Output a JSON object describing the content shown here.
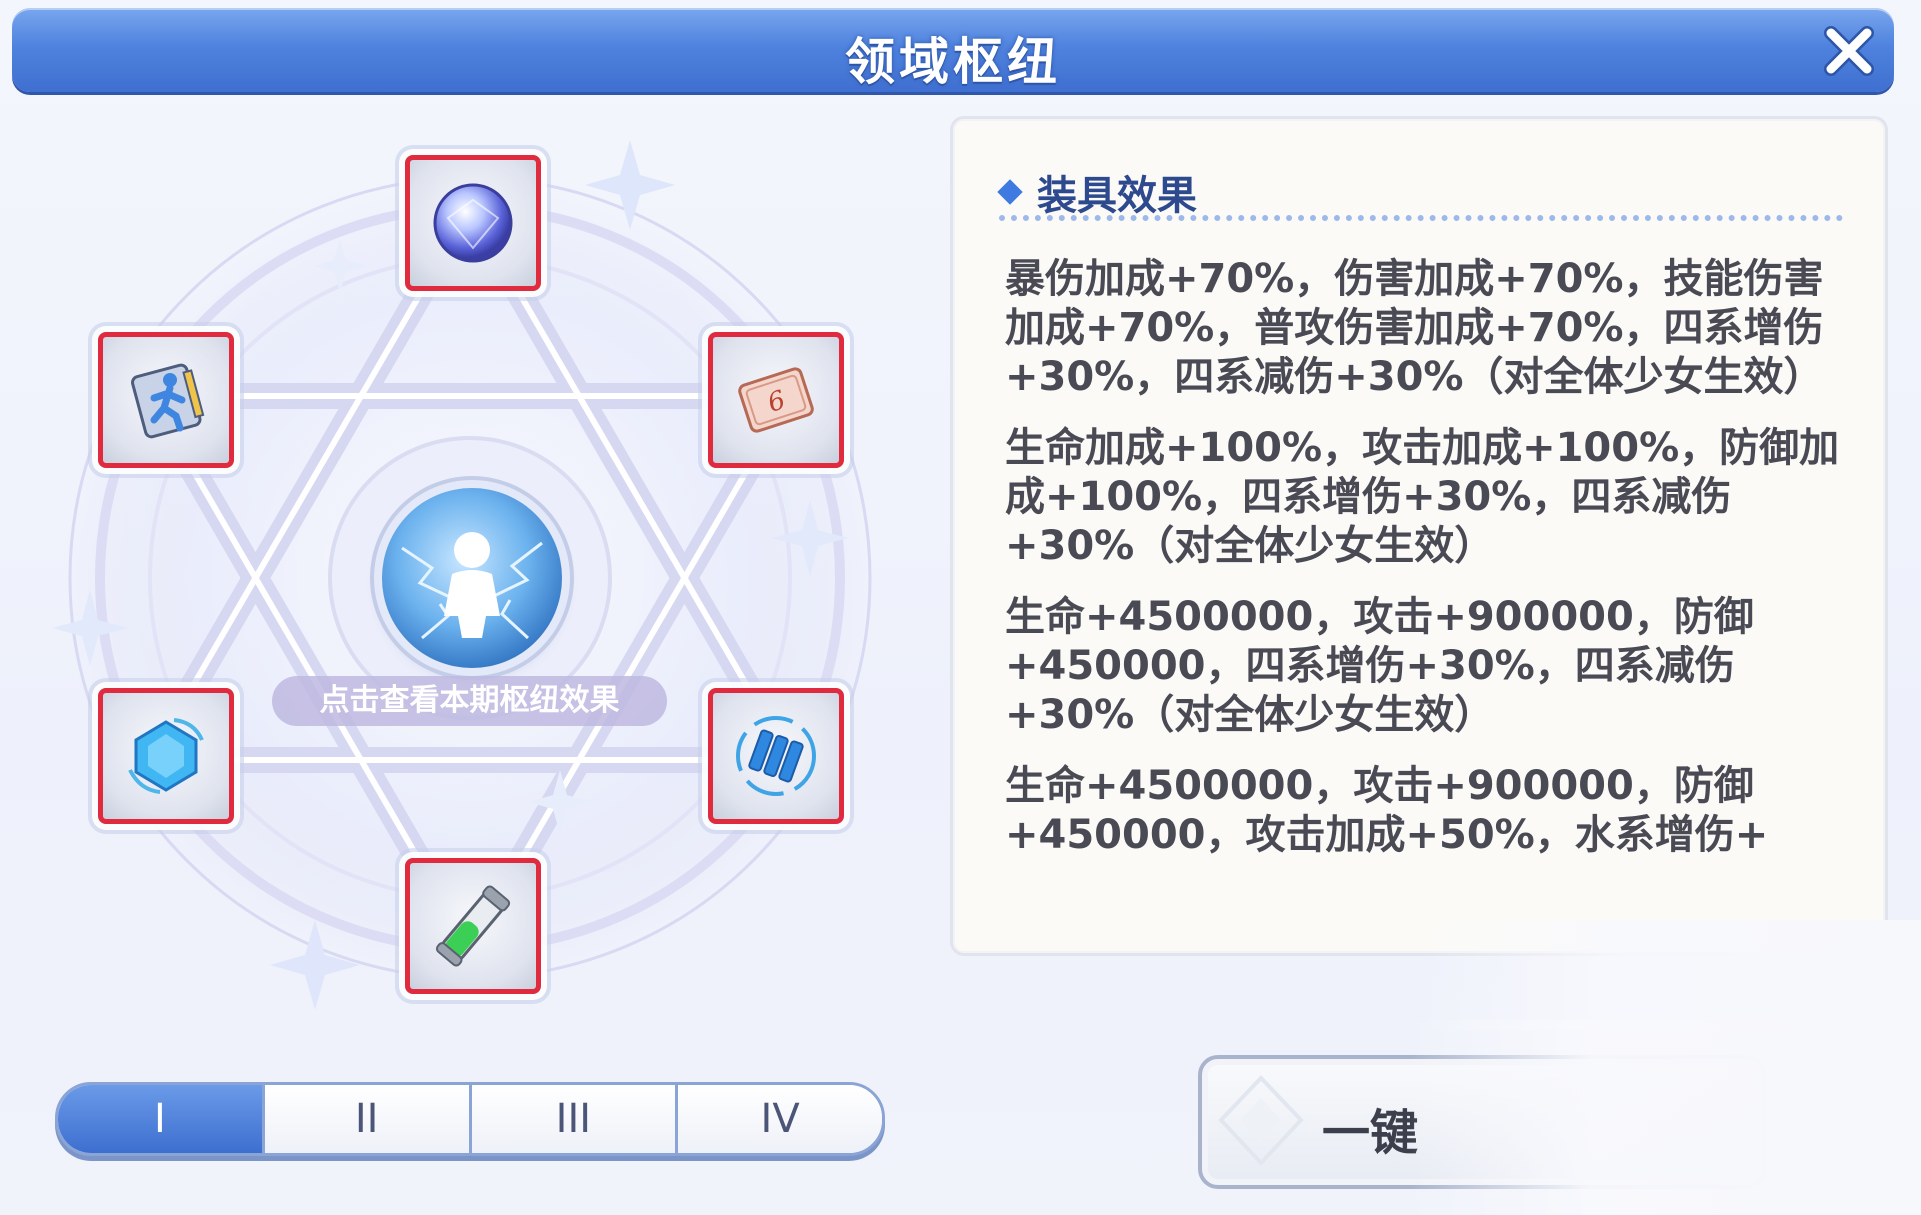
{
  "window": {
    "title": "领域枢纽",
    "close_icon": "close-icon"
  },
  "circle": {
    "center_caption": "点击查看本期枢纽效果",
    "center_icon": "lightning-figure-icon",
    "slots": [
      {
        "position": "top",
        "icon": "crystal-orb-icon"
      },
      {
        "position": "upper-right",
        "icon": "dice-card-icon"
      },
      {
        "position": "lower-right",
        "icon": "water-battery-icon"
      },
      {
        "position": "bottom",
        "icon": "green-vial-icon"
      },
      {
        "position": "lower-left",
        "icon": "water-gem-icon"
      },
      {
        "position": "upper-left",
        "icon": "runner-book-icon"
      }
    ],
    "card_number": "6"
  },
  "tabs": [
    {
      "label": "I",
      "active": true
    },
    {
      "label": "II",
      "active": false
    },
    {
      "label": "III",
      "active": false
    },
    {
      "label": "IV",
      "active": false
    }
  ],
  "info": {
    "header": "装具效果",
    "effects": [
      "暴伤加成+70%，伤害加成+70%，技能伤害加成+70%，普攻伤害加成+70%，四系增伤+30%，四系减伤+30%（对全体少女生效）",
      "生命加成+100%，攻击加成+100%，防御加成+100%，四系增伤+30%，四系减伤+30%（对全体少女生效）",
      "生命+4500000，攻击+900000，防御+450000，四系增伤+30%，四系减伤+30%（对全体少女生效）",
      "生命+4500000，攻击+900000，防御+450000，攻击加成+50%，水系增伤+"
    ]
  },
  "actions": {
    "onekey_label": "一键"
  },
  "colors": {
    "title_blue": "#4f83de",
    "slot_border_red": "#e02b3e",
    "tab_active": "#3d6fd0",
    "header_text": "#2e4a8e"
  }
}
